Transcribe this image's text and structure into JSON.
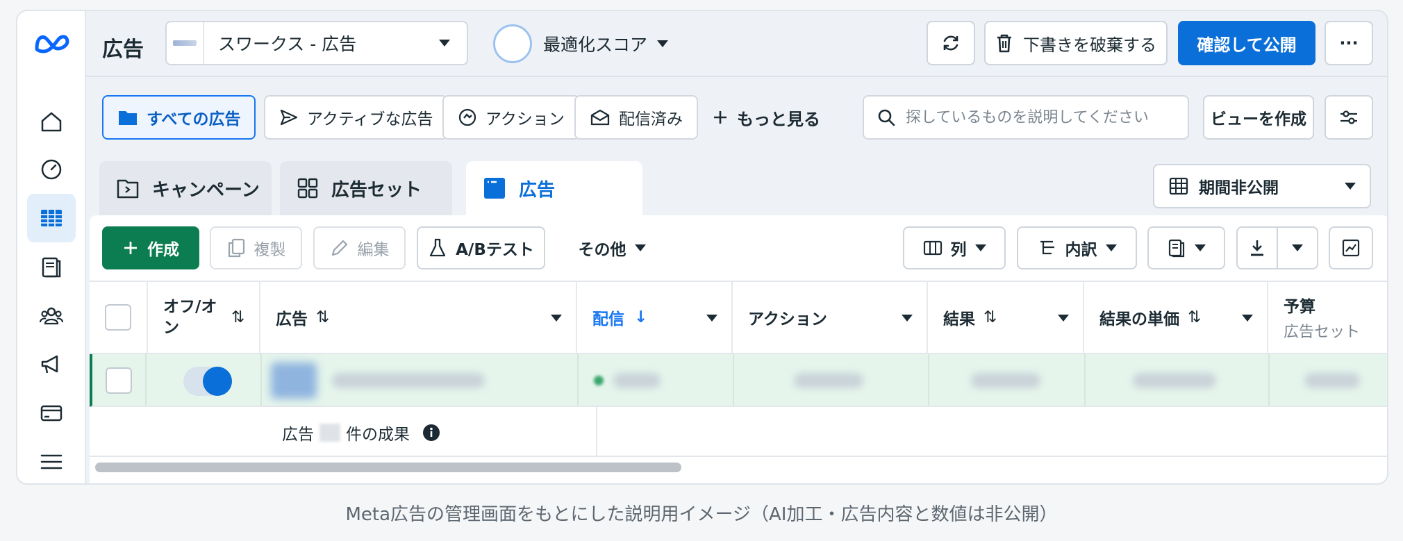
{
  "header": {
    "title": "広告",
    "account_name": "スワークス - 広告",
    "score_label": "最適化スコア",
    "discard_label": "下書きを破棄する",
    "publish_label": "確認して公開",
    "more_label": "···"
  },
  "filters": {
    "all_ads": "すべての広告",
    "active_ads": "アクティブな広告",
    "actions": "アクション",
    "delivered": "配信済み",
    "see_more": "もっと見る",
    "search_placeholder": "探しているものを説明してください",
    "create_view": "ビューを作成"
  },
  "tabs": {
    "campaign": "キャンペーン",
    "adset": "広告セット",
    "ad": "広告",
    "period": "期間非公開"
  },
  "toolbar": {
    "create": "作成",
    "duplicate": "複製",
    "edit": "編集",
    "ab_test": "A/Bテスト",
    "other": "その他",
    "columns": "列",
    "breakdown": "内訳"
  },
  "table": {
    "headers": {
      "onoff": "オフ/オン",
      "ad": "広告",
      "delivery": "配信",
      "actions": "アクション",
      "results": "結果",
      "cost_per_result": "結果の単価",
      "budget": "予算",
      "budget_sub": "広告セット"
    },
    "footer_prefix": "広告",
    "footer_suffix": "件の成果"
  },
  "caption": "Meta広告の管理画面をもとにした説明用イメージ（AI加工・広告内容と数値は非公開）",
  "colors": {
    "primary": "#0a6fd8",
    "create_green": "#0c7d51",
    "row_highlight": "#e5f5ec"
  }
}
